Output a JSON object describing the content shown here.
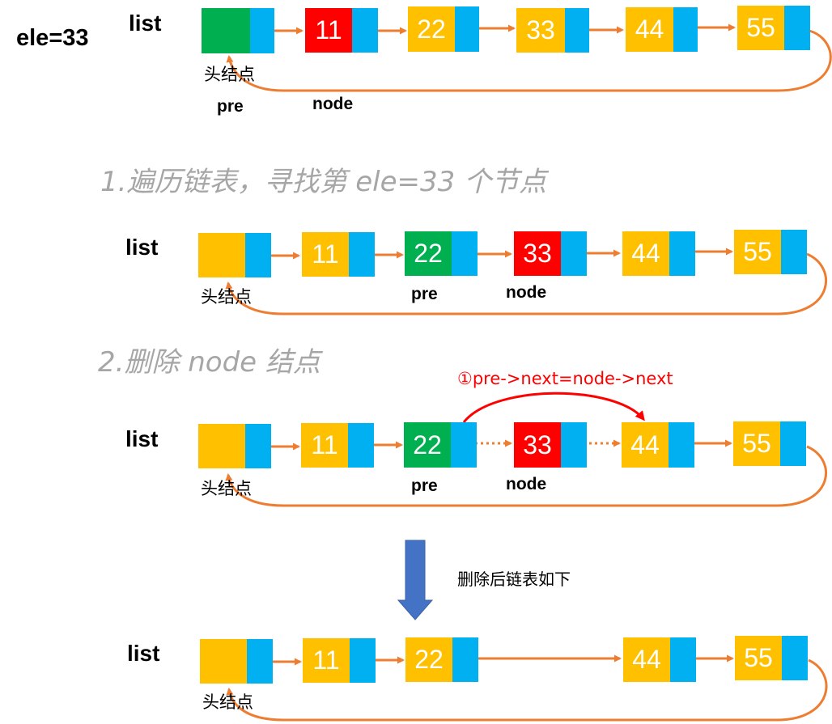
{
  "ele_label": "ele=33",
  "list_label": "list",
  "head_label": "头结点",
  "pre_label": "pre",
  "node_label": "node",
  "step1": "1.遍历链表，寻找第 ele=33 个节点",
  "step2": "2.删除  node  结点",
  "annotation": "①pre->next=node->next",
  "after_label": "删除后链表如下",
  "values": [
    "11",
    "22",
    "33",
    "44",
    "55"
  ],
  "colors": {
    "data_orange": "#ffc000",
    "head_green": "#00b050",
    "highlight_red": "#ff0000",
    "next_blue": "#00b0f0",
    "arrow_orange": "#ed7d31",
    "annotation_red": "#ff0000",
    "down_arrow_blue": "#4472c4",
    "step_gray": "#a6a6a6"
  }
}
